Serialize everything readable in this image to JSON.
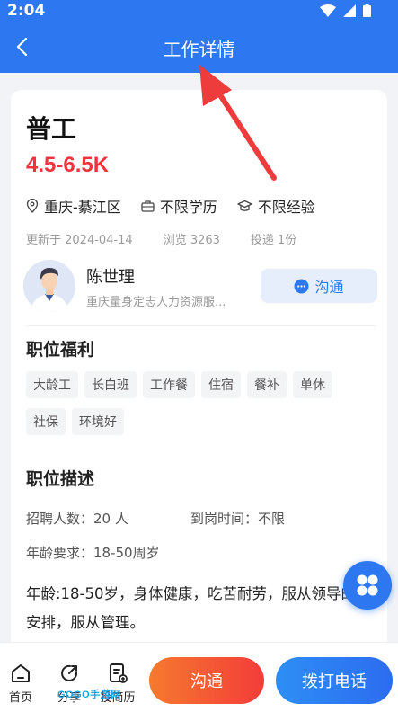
{
  "status": {
    "time": "2:04"
  },
  "header": {
    "title": "工作详情"
  },
  "job": {
    "title": "普工",
    "salary": "4.5-6.5K",
    "location": "重庆-綦江区",
    "education": "不限学历",
    "experience": "不限经验",
    "updated": "更新于 2024-04-14",
    "views": "浏览 3263",
    "applications": "投递 1份"
  },
  "recruiter": {
    "name": "陈世理",
    "company": "重庆量身定志人力资源服...",
    "chat_label": "沟通"
  },
  "benefits": {
    "title": "职位福利",
    "tags": [
      "大龄工",
      "长白班",
      "工作餐",
      "住宿",
      "餐补",
      "单休",
      "社保",
      "环境好"
    ]
  },
  "description": {
    "title": "职位描述",
    "headcount_label": "招聘人数：",
    "headcount_value": "20 人",
    "arrival_label": "到岗时间：",
    "arrival_value": "不限",
    "age_label": "年龄要求：",
    "age_value": "18-50周岁",
    "text": "年龄:18-50岁，身体健康，吃苦耐劳，服从领导的安排，服从管理。"
  },
  "bottom_nav": {
    "home": "首页",
    "share": "分享",
    "resume": "投简历",
    "chat_button": "沟通",
    "call_button": "拨打电话"
  },
  "watermark": "GOGO手游网",
  "colors": {
    "primary": "#2d78f0",
    "salary": "#f0343d",
    "chat_gradient_start": "#f57a2e",
    "chat_gradient_end": "#f43c3a"
  }
}
